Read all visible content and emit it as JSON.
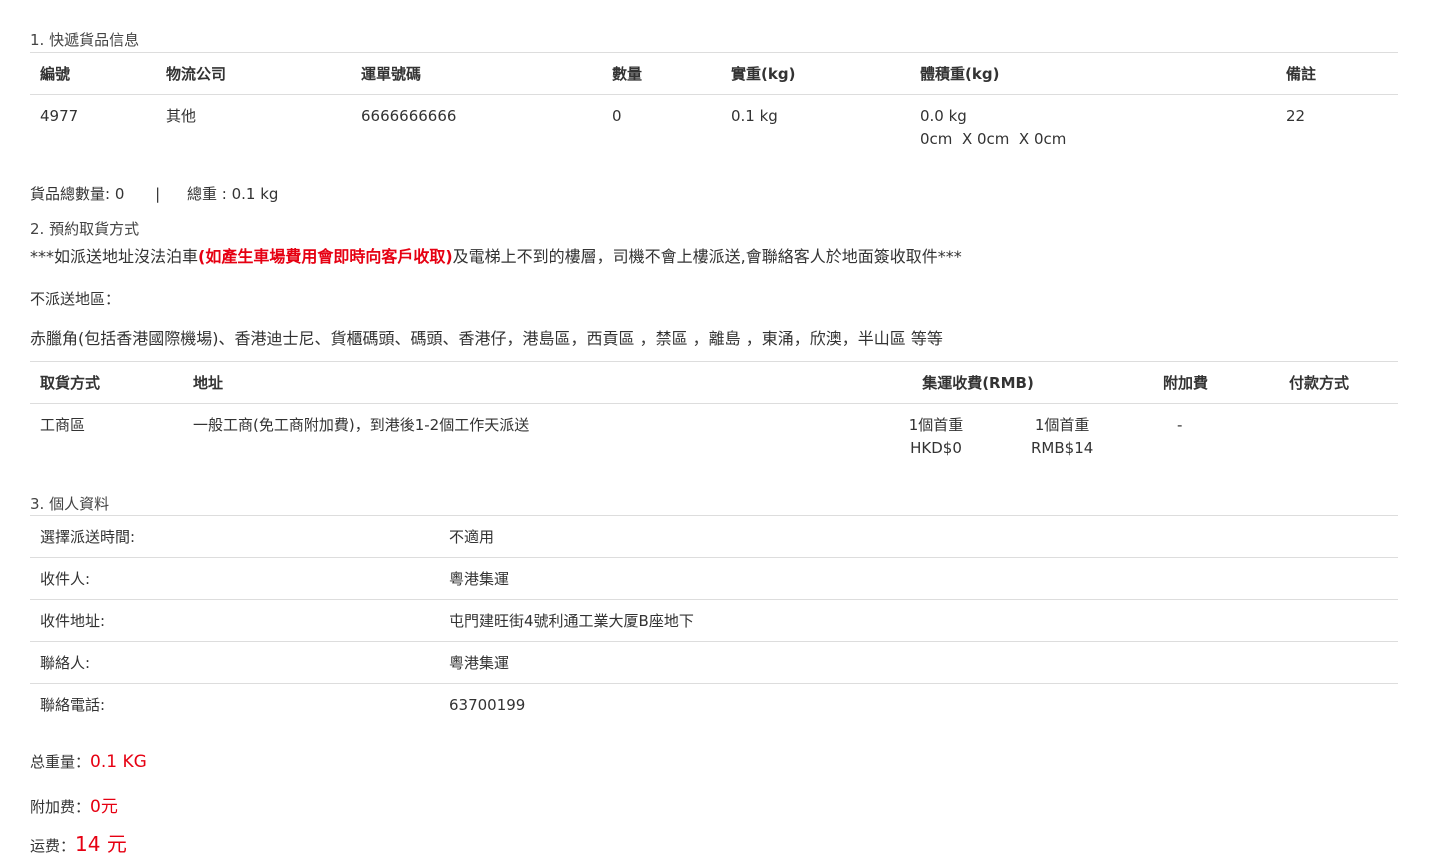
{
  "sections": {
    "goods_title": "1. 快遞貨品信息",
    "pickup_title": "2. 預約取貨方式",
    "personal_title": "3. 個人資料"
  },
  "goods_table": {
    "headers": [
      "編號",
      "物流公司",
      "運單號碼",
      "數量",
      "實重(kg)",
      "體積重(kg)",
      "備註"
    ],
    "row": {
      "id": "4977",
      "company": "其他",
      "tracking": "6666666666",
      "qty": "0",
      "weight": "0.1 kg",
      "vol_weight": "0.0 kg",
      "dims": "0cm  X 0cm  X 0cm",
      "remark": "22"
    }
  },
  "goods_summary": {
    "count_label": "貨品總數量: 0",
    "separator": "|",
    "weight_label": "總重 : 0.1 kg"
  },
  "notice": {
    "prefix": "***如派送地址沒法泊車",
    "highlight": "(如產生車場費用會即時向客戶收取)",
    "suffix": "及電梯上不到的樓層，司機不會上樓派送,會聯絡客人於地面簽收取件***"
  },
  "no_delivery": {
    "label": "不派送地區：",
    "areas": "赤臘角(包括香港國際機場)、香港迪士尼、貨櫃碼頭、碼頭、香港仔，港島區，西貢區 ，禁區 ，離島 ，東涌，欣澳，半山區 等等"
  },
  "pickup_table": {
    "headers": [
      "取貨方式",
      "地址",
      "集運收費(RMB)",
      "附加費",
      "付款方式"
    ],
    "row": {
      "method": "工商區",
      "address": "一般工商(免工商附加費)，到港後1-2個工作天派送",
      "fee1_line1": "1個首重",
      "fee1_line2": "HKD$0",
      "fee2_line1": "1個首重",
      "fee2_line2": "RMB$14",
      "surcharge": "-",
      "payment": ""
    }
  },
  "personal": [
    {
      "label": "選擇派送時間:",
      "value": "不適用"
    },
    {
      "label": "收件人:",
      "value": "粵港集運"
    },
    {
      "label": "收件地址:",
      "value": "屯門建旺街4號利通工業大厦B座地下"
    },
    {
      "label": "聯絡人:",
      "value": "粵港集運"
    },
    {
      "label": "聯絡電話:",
      "value": "63700199"
    }
  ],
  "totals": {
    "weight_label": "总重量：",
    "weight_value": "0.1 KG",
    "surcharge_label": "附加费：",
    "surcharge_value": "0元",
    "freight_label": "运费：",
    "freight_value": "14 元"
  },
  "colors": {
    "accent_red": "#e60012",
    "border": "#dddddd"
  }
}
